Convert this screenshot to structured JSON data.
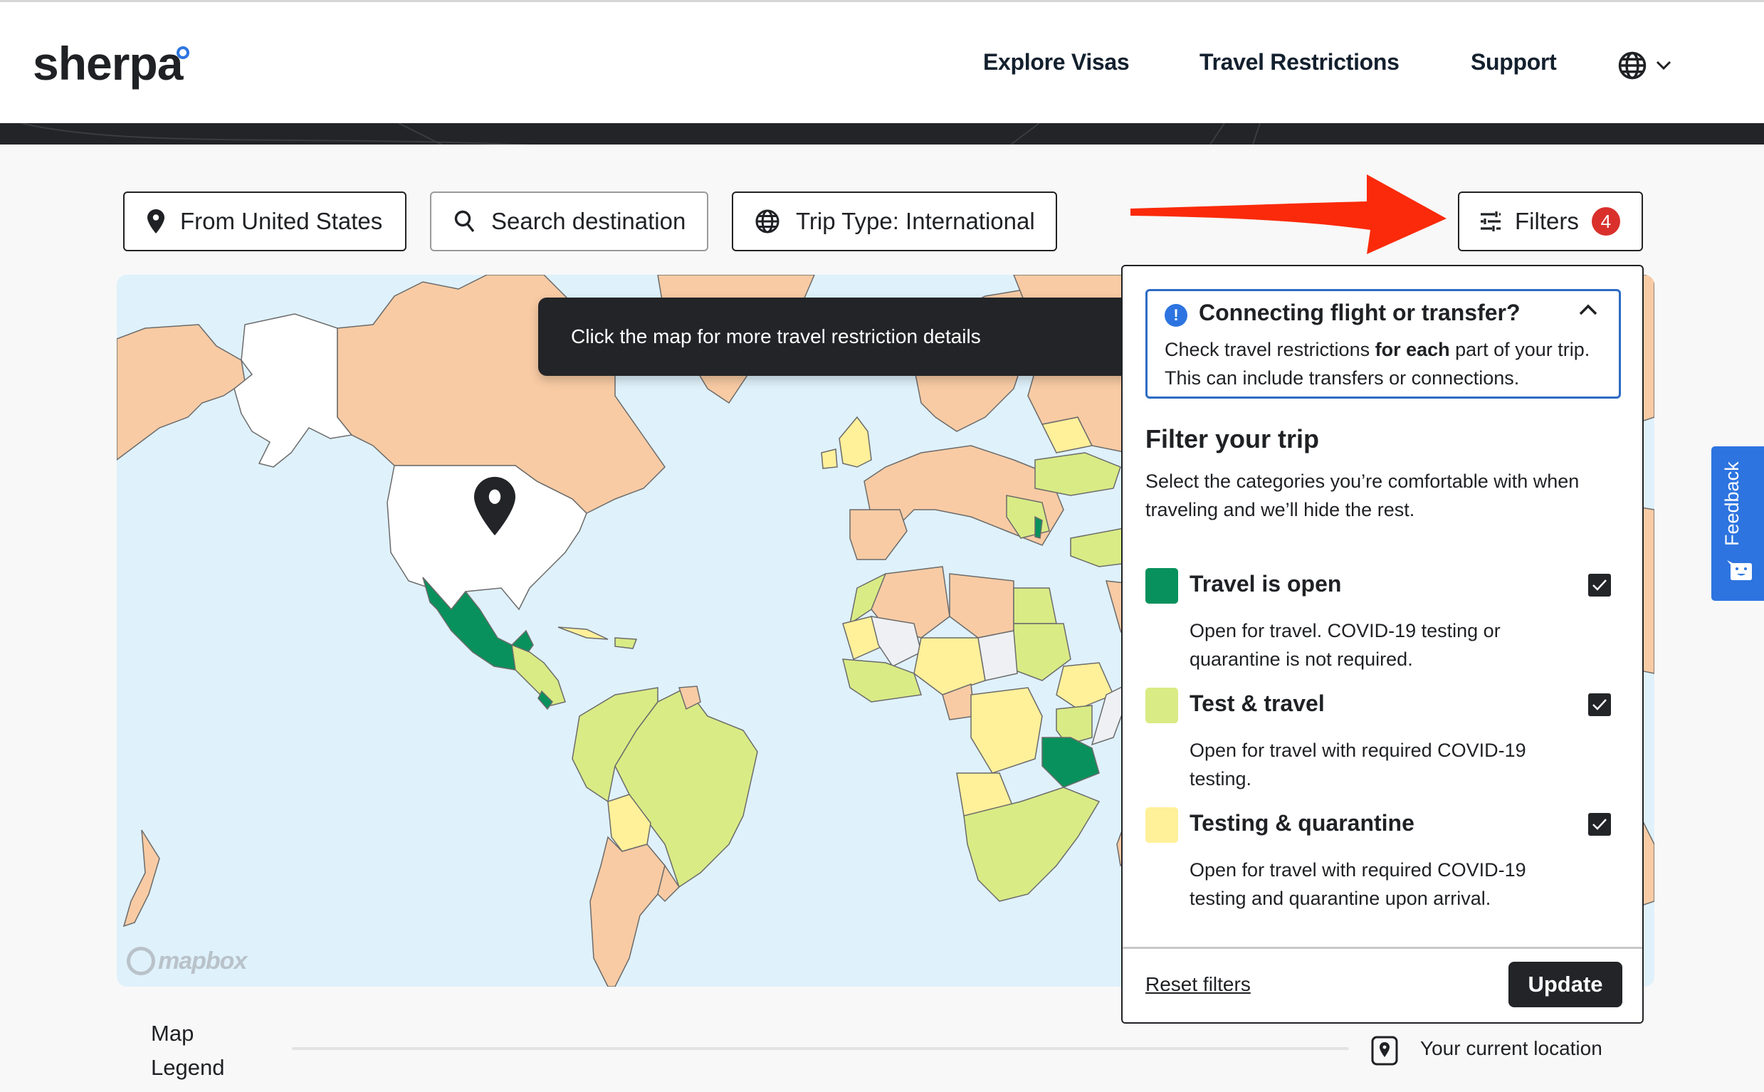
{
  "header": {
    "logo": "sherpa",
    "nav": [
      "Explore Visas",
      "Travel Restrictions",
      "Support"
    ],
    "language_icon": "globe-icon"
  },
  "toolbar": {
    "from_label": "From United States",
    "search_placeholder": "Search destination",
    "trip_type_label": "Trip Type: International",
    "filters_label": "Filters",
    "filters_count": "4"
  },
  "map": {
    "tooltip": "Click the map for more travel restriction details",
    "attribution": "mapbox",
    "colors": {
      "water": "#dff1fb",
      "travel_open": "#08915c",
      "test_travel": "#d9eb85",
      "testing_quarantine": "#fff09a",
      "restricted": "#f8cba4",
      "no_data": "#eef0f3",
      "origin": "#ffffff"
    }
  },
  "filter_panel": {
    "callout": {
      "title": "Connecting flight or transfer?",
      "body_pre": "Check travel restrictions ",
      "body_bold": "for each",
      "body_post": " part of your trip. This can include transfers or connections."
    },
    "title": "Filter your trip",
    "description": "Select the categories you’re comfortable with when traveling and we’ll hide the rest.",
    "categories": [
      {
        "name": "Travel is open",
        "description": "Open for travel. COVID-19 testing or quarantine is not required.",
        "color": "#08915c",
        "checked": true
      },
      {
        "name": "Test & travel",
        "description": "Open for travel with required COVID-19 testing.",
        "color": "#d9eb85",
        "checked": true
      },
      {
        "name": "Testing & quarantine",
        "description": "Open for travel with required COVID-19 testing and quarantine upon arrival.",
        "color": "#fff09a",
        "checked": true
      }
    ],
    "reset_label": "Reset filters",
    "update_label": "Update"
  },
  "feedback": {
    "label": "Feedback"
  },
  "legend": {
    "title": "Map Legend",
    "current_location": "Your current location"
  },
  "colors": {
    "accent_blue": "#2d74e0",
    "badge_red": "#d9302c",
    "annotation_arrow": "#fa2a0a",
    "dark": "#222427"
  }
}
